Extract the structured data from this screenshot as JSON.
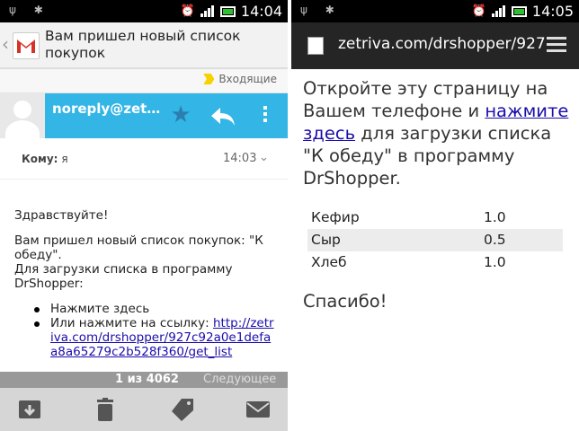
{
  "left": {
    "status": {
      "time": "14:04"
    },
    "header": {
      "subject": "Вам пришел новый список покупок"
    },
    "label": "Входящие",
    "sender": {
      "name": "noreply@zet…"
    },
    "recipient": {
      "label": "Кому:",
      "value": "я",
      "time": "14:03"
    },
    "body": {
      "greeting": "Здравствуйте!",
      "line1": "Вам пришел новый список покупок: \"К обеду\".",
      "line2": "Для загрузки списка в программу DrShopper:",
      "bullet1": "Нажмите здесь",
      "bullet2_prefix": "Или нажмите на ссылку: ",
      "bullet2_link": "http://zetriva.com/drshopper/927c92a0e1defaa8a65279c2b528f360/get_list"
    },
    "pager": {
      "count": "1 из 4062",
      "next": "Следующее"
    }
  },
  "right": {
    "status": {
      "time": "14:05"
    },
    "browser": {
      "url": "zetriva.com/drshopper/927"
    },
    "intro": {
      "prefix": "Откройте эту страницу на Вашем телефоне и ",
      "link": "нажмите здесь",
      "suffix": " для загрузки списка \"К обеду\" в программу DrShopper."
    },
    "items": [
      {
        "name": "Кефир",
        "qty": "1.0"
      },
      {
        "name": "Сыр",
        "qty": "0.5"
      },
      {
        "name": "Хлеб",
        "qty": "1.0"
      }
    ],
    "thanks": "Спасибо!"
  },
  "colors": {
    "sender_bar": "#33b5e5",
    "link": "#1a0dab",
    "status_bar": "#000000",
    "browser_bar": "#252525"
  }
}
